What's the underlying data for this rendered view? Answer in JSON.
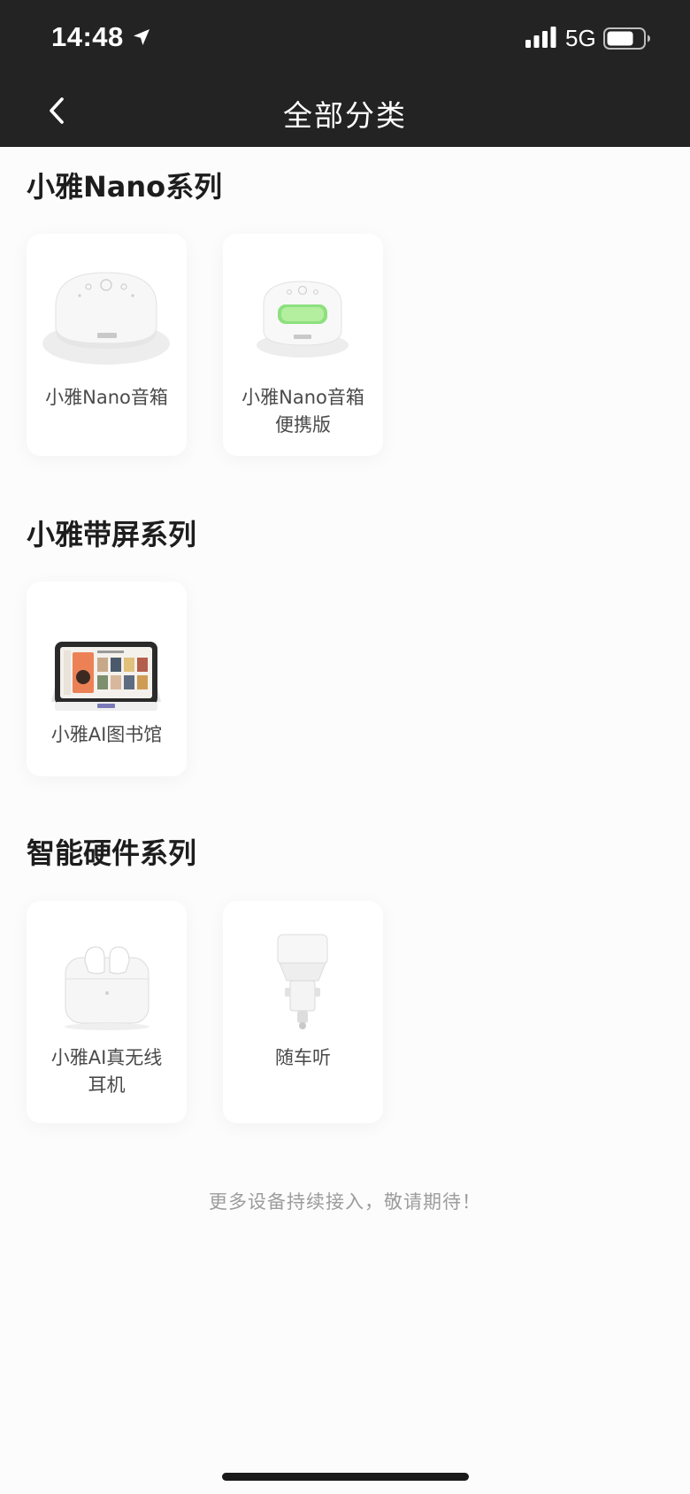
{
  "status_bar": {
    "time": "14:48",
    "network": "5G",
    "icons": [
      "location-arrow-icon",
      "signal-bars-icon",
      "battery-icon"
    ]
  },
  "nav": {
    "title": "全部分类",
    "back_icon": "chevron-left-icon"
  },
  "sections": [
    {
      "title": "小雅Nano系列",
      "items": [
        {
          "label_lines": [
            "小雅Nano音箱"
          ],
          "image": "nano-speaker-image"
        },
        {
          "label_lines": [
            "小雅Nano音箱",
            "便携版"
          ],
          "image": "nano-portable-speaker-image"
        }
      ]
    },
    {
      "title": "小雅带屏系列",
      "items": [
        {
          "label_lines": [
            "小雅AI图书馆"
          ],
          "image": "ai-library-screen-image"
        }
      ]
    },
    {
      "title": "智能硬件系列",
      "items": [
        {
          "label_lines": [
            "小雅AI真无线",
            "耳机"
          ],
          "image": "wireless-earbuds-image"
        },
        {
          "label_lines": [
            "随车听"
          ],
          "image": "car-charger-image"
        }
      ]
    }
  ],
  "footer": {
    "note": "更多设备持续接入，敬请期待！"
  },
  "colors": {
    "header_bg": "#232323",
    "page_bg": "#fcfcfc",
    "card_bg": "#ffffff",
    "title_text": "#1d1d1d",
    "label_text": "#4a4a4a",
    "note_text": "#9c9c9c",
    "portable_led": "#8de07e"
  }
}
